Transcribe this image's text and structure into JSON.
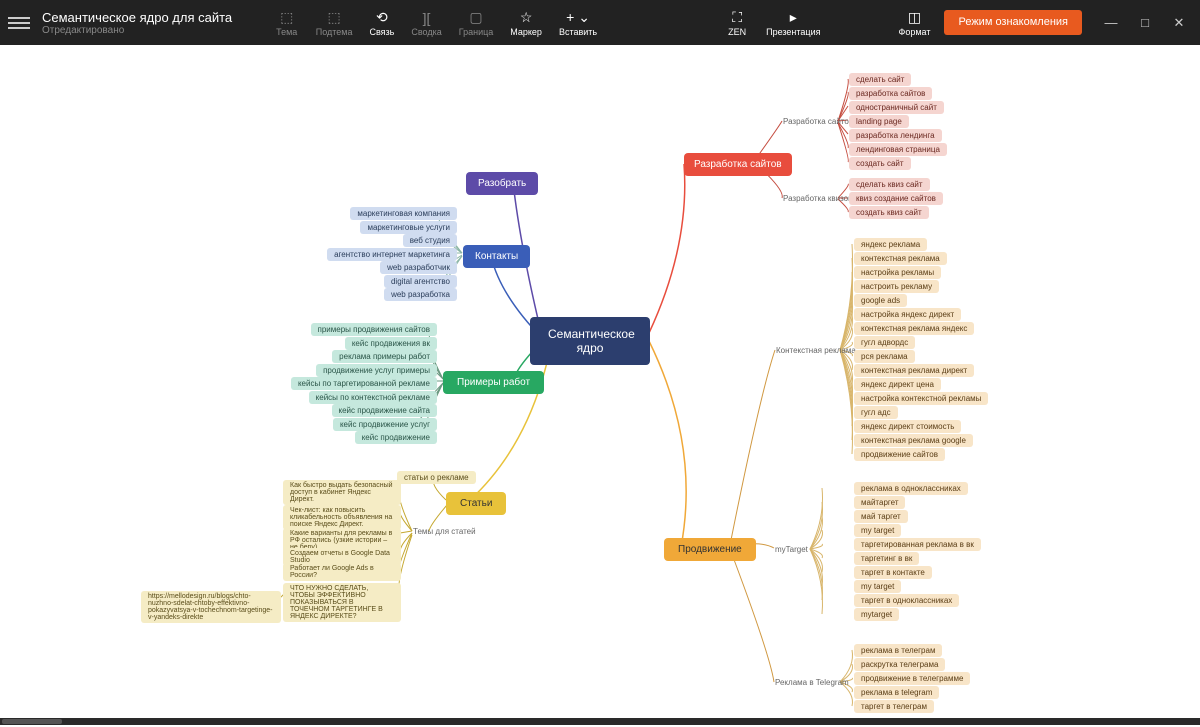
{
  "header": {
    "title": "Семантическое ядро для сайта",
    "subtitle": "Отредактировано",
    "mode_button": "Режим ознакомления"
  },
  "toolbar": {
    "tema": "Тема",
    "podtema": "Подтема",
    "svyaz": "Связь",
    "svodka": "Сводка",
    "granitsa": "Граница",
    "marker": "Маркер",
    "vstavit": "Вставить",
    "zen": "ZEN",
    "prezent": "Презентация",
    "format": "Формат"
  },
  "mindmap": {
    "central": "Семантическое ядро",
    "branches": {
      "razobrat": {
        "label": "Разобрать"
      },
      "kontakty": {
        "label": "Контакты",
        "leaves": [
          "маркетинговая компания",
          "маркетинговые услуги",
          "веб студия",
          "агентство интернет маркетинга",
          "web разработчик",
          "digital агентство",
          "web разработка"
        ]
      },
      "primery": {
        "label": "Примеры работ",
        "leaves": [
          "примеры продвижения сайтов",
          "кейс продвижения вк",
          "реклама примеры работ",
          "продвижение услуг примеры",
          "кейсы по таргетированной рекламе",
          "кейсы по контекстной рекламе",
          "кейс продвижение сайта",
          "кейс продвижение услуг",
          "кейс продвижение"
        ]
      },
      "stati": {
        "label": "Статьи",
        "leaf_top": "статьи о рекламе",
        "subgroup": "Темы для статей",
        "leaves": [
          "Как быстро выдать безопасный доступ в кабинет Яндекс Директ.",
          "Чек-лист: как повысить кликабельность объявления на поиске Яндекс Директ.",
          "Какие варианты для рекламы в РФ остались (узкие истории – не беру).",
          "Создаем отчеты в Google Data Studio",
          "Работает ли Google Ads в России?",
          "ЧТО НУЖНО СДЕЛАТЬ, ЧТОБЫ ЭФФЕКТИВНО ПОКАЗЫВАТЬСЯ В ТОЧЕЧНОМ ТАРГЕТИНГЕ В ЯНДЕКС ДИРЕКТЕ?"
        ],
        "extra": "https://mellodesign.ru/blogs/chto-nuzhno-sdelat-chtoby-effektivno-pokazyvatsya-v-tochechnom-targetinge-v-yandeks-direkte"
      },
      "razrabotka": {
        "label": "Разработка сайтов",
        "sub1": "Разработка сайтов",
        "sub1_leaves": [
          "сделать сайт",
          "разработка сайтов",
          "одностраничный сайт",
          "landing page",
          "разработка лендинга",
          "лендинговая страница",
          "создать сайт"
        ],
        "sub2": "Разработка квизов",
        "sub2_leaves": [
          "сделать квиз сайт",
          "квиз создание сайтов",
          "создать квиз сайт"
        ]
      },
      "prodvizhenie": {
        "label": "Продвижение",
        "sub1": "Контекстная реклама",
        "sub1_leaves": [
          "яндекс реклама",
          "контекстная реклама",
          "настройка рекламы",
          "настроить рекламу",
          "google ads",
          "настройка яндекс директ",
          "контекстная реклама яндекс",
          "гугл адвордс",
          "рся реклама",
          "контекстная реклама директ",
          "яндекс директ цена",
          "настройка контекстной рекламы",
          "гугл адс",
          "яндекс директ стоимость",
          "контекстная реклама google",
          "продвижение сайтов"
        ],
        "sub2": "myTarget",
        "sub2_leaves": [
          "реклама в одноклассниках",
          "майтаргет",
          "май таргет",
          "my target",
          "таргетированная реклама в вк",
          "таргетинг в вк",
          "таргет в контакте",
          "my target",
          "таргет в одноклассниках",
          "mytarget"
        ],
        "sub3": "Реклама в Telegram",
        "sub3_leaves": [
          "реклама в телеграм",
          "раскрутка телеграма",
          "продвижение в телеграмме",
          "реклама в telegram",
          "таргет в телеграм"
        ]
      }
    }
  }
}
